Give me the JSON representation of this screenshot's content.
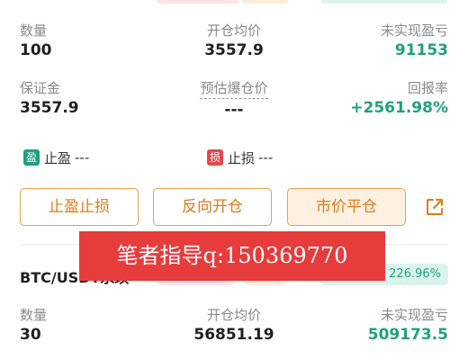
{
  "position1": {
    "row1": {
      "quantity_label": "数量",
      "quantity_value": "100",
      "avg_open_label": "开仓均价",
      "avg_open_value": "3557.9",
      "unrealized_pnl_label": "未实现盈亏",
      "unrealized_pnl_value": "91153"
    },
    "row2": {
      "margin_label": "保证金",
      "margin_value": "3557.9",
      "est_liq_label": "预估爆仓价",
      "est_liq_value": "---",
      "roe_label": "回报率",
      "roe_value": "+2561.98%"
    },
    "take_profit": {
      "tag": "盈",
      "label": "止盈",
      "value": "---"
    },
    "stop_loss": {
      "tag": "损",
      "label": "止损",
      "value": "---"
    },
    "buttons": {
      "tp_sl": "止盈止损",
      "reverse_open": "反向开仓",
      "market_close": "市价平仓"
    }
  },
  "position2": {
    "symbol": "BTC/USDT永续",
    "margin_ratio_tag": "保证金率 226.96%",
    "row1": {
      "quantity_label": "数量",
      "quantity_value": "30",
      "avg_open_label": "开仓均价",
      "avg_open_value": "56851.19",
      "unrealized_pnl_label": "未实现盈亏",
      "unrealized_pnl_value": "509173.5"
    }
  },
  "watermark": {
    "text": "笔者指导q:150369770"
  },
  "colors": {
    "green": "#1fa07f",
    "orange": "#e07a18",
    "orange_border": "#e8a14a",
    "tp_tag": "#1fa07f",
    "sl_tag": "#e5484d",
    "watermark_bg": "#e63c3c"
  },
  "icons": {
    "share": "share-external-icon"
  }
}
